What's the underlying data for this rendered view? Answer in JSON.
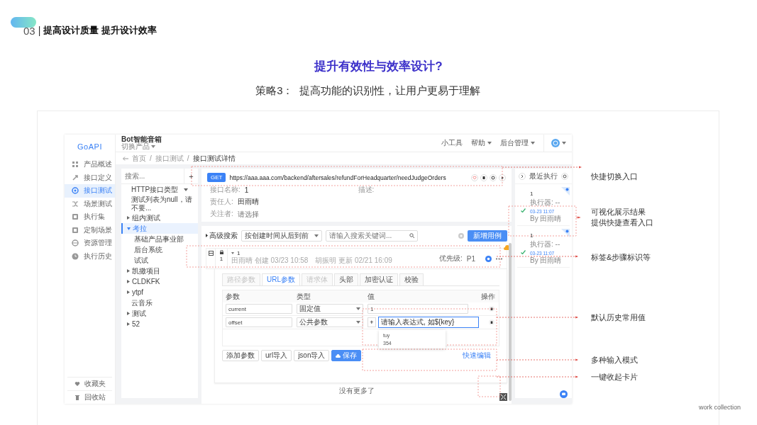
{
  "slide_header": {
    "number": "03",
    "separator": "|",
    "title": "提高设计质量 提升设计效率"
  },
  "headline": "提升有效性与效率设计?",
  "subtitle": "策略3：  提高功能的识别性，让用户更易于理解",
  "app": {
    "logo": "GoAPI",
    "nav": [
      {
        "label": "产品概述",
        "selected": false
      },
      {
        "label": "接口定义",
        "selected": false
      },
      {
        "label": "接口测试",
        "selected": true
      },
      {
        "label": "场景测试",
        "selected": false
      },
      {
        "label": "执行集",
        "selected": false
      },
      {
        "label": "定制场景",
        "selected": false
      },
      {
        "label": "资源管理",
        "selected": false
      },
      {
        "label": "执行历史",
        "selected": false
      }
    ],
    "nav_bottom": [
      {
        "label": "收藏夹"
      },
      {
        "label": "回收站"
      }
    ],
    "product": {
      "name": "Bot智能音箱",
      "switch": "切换产品"
    },
    "top_menu": [
      {
        "label": "小工具",
        "dropdown": false
      },
      {
        "label": "帮助",
        "dropdown": true
      },
      {
        "label": "后台管理",
        "dropdown": true
      }
    ],
    "breadcrumb": {
      "items": [
        "首页",
        "接口测试",
        "接口测试详情"
      ],
      "separators": [
        "/",
        "/"
      ]
    },
    "tree": {
      "search_placeholder": "搜索...",
      "add": "+",
      "type_filter": "HTTP接口类型",
      "items": [
        {
          "label": "测试列表为null，请不要...",
          "selected": false
        },
        {
          "label": "组内测试",
          "expanded": false,
          "selected": false
        },
        {
          "label": "考拉",
          "expanded": true,
          "selected": true,
          "children": [
            {
              "label": "基础产品事业部",
              "selected": false
            },
            {
              "label": "后台系统",
              "selected": false
            },
            {
              "label": "试试",
              "selected": false
            }
          ]
        },
        {
          "label": "凯撒项目",
          "expanded": false,
          "selected": false
        },
        {
          "label": "CLDKFK",
          "expanded": false,
          "selected": false
        },
        {
          "label": "ytpf",
          "expanded": false,
          "selected": false
        },
        {
          "label": "云音乐",
          "selected": false
        },
        {
          "label": "测试",
          "expanded": false,
          "selected": false
        },
        {
          "label": "52",
          "expanded": false,
          "selected": false
        }
      ]
    },
    "request": {
      "method": "GET",
      "url": "https://aaa.aaa.com/backend/aftersales/refundForHeadquarter/needJudgeOrders",
      "fields": [
        {
          "label": "接口名称:",
          "value": "1"
        },
        {
          "label": "描述:"
        },
        {
          "label": "责任人:",
          "value": "田雨晴"
        },
        {
          "label": "关注者:",
          "placeholder": "请选择"
        }
      ]
    },
    "case_toolbar": {
      "advanced": "高级搜索",
      "sort": "按创建时间从后到前",
      "search_placeholder": "请输入搜索关键词...",
      "add_button": "新增用例"
    },
    "cases": [
      {
        "index": "1",
        "name": "1",
        "meta": [
          "田雨晴 创建 03/23 10:58",
          "胡振明 更新 02/21 16:09"
        ],
        "priority_label": "优先级:",
        "priority": "P1",
        "expanded": true
      }
    ],
    "param_tabs": [
      {
        "label": "路径参数",
        "selected": false,
        "disabled": true
      },
      {
        "label": "URL参数",
        "selected": true,
        "disabled": false
      },
      {
        "label": "请求体",
        "selected": false,
        "disabled": true
      },
      {
        "label": "头部",
        "selected": false,
        "disabled": false
      },
      {
        "label": "加密认证",
        "selected": false,
        "disabled": false
      },
      {
        "label": "校验",
        "selected": false,
        "disabled": false
      }
    ],
    "param_columns": [
      "参数",
      "类型",
      "值",
      "操作"
    ],
    "params": [
      {
        "name": "current",
        "type": "固定值",
        "value": "1",
        "focused": false
      },
      {
        "name": "offset",
        "type": "公共参数",
        "add_button": "+",
        "value_placeholder": "请输入表达式, 如${key}",
        "focused": true,
        "suggestions": [
          "tuy",
          "354"
        ]
      }
    ],
    "param_buttons": [
      {
        "label": "添加参数",
        "primary": false
      },
      {
        "label": "url导入",
        "primary": false
      },
      {
        "label": "json导入",
        "primary": false
      },
      {
        "label": "保存",
        "primary": true
      }
    ],
    "quick_edit": "快速编辑",
    "list_end": "没有更多了",
    "recent": {
      "title": "最近执行",
      "items": [
        {
          "name": "1",
          "passed": true,
          "executor": "执行器: --",
          "time": "03-23 11:07",
          "by": "By 田雨晴"
        },
        {
          "name": "1",
          "passed": true,
          "executor": "执行器: --",
          "time": "03-23 11:07",
          "by": "By 田雨晴"
        }
      ]
    }
  },
  "annotations": [
    {
      "lines": [
        "快捷切换入口"
      ]
    },
    {
      "lines": [
        "可视化展示结果",
        "提供快捷查看入口"
      ]
    },
    {
      "lines": [
        "标签&步骤标识等"
      ]
    },
    {
      "lines": [
        "默认历史常用值"
      ]
    },
    {
      "lines": [
        "多种输入模式"
      ]
    },
    {
      "lines": [
        "一键收起卡片"
      ]
    }
  ],
  "footer": "work collection"
}
